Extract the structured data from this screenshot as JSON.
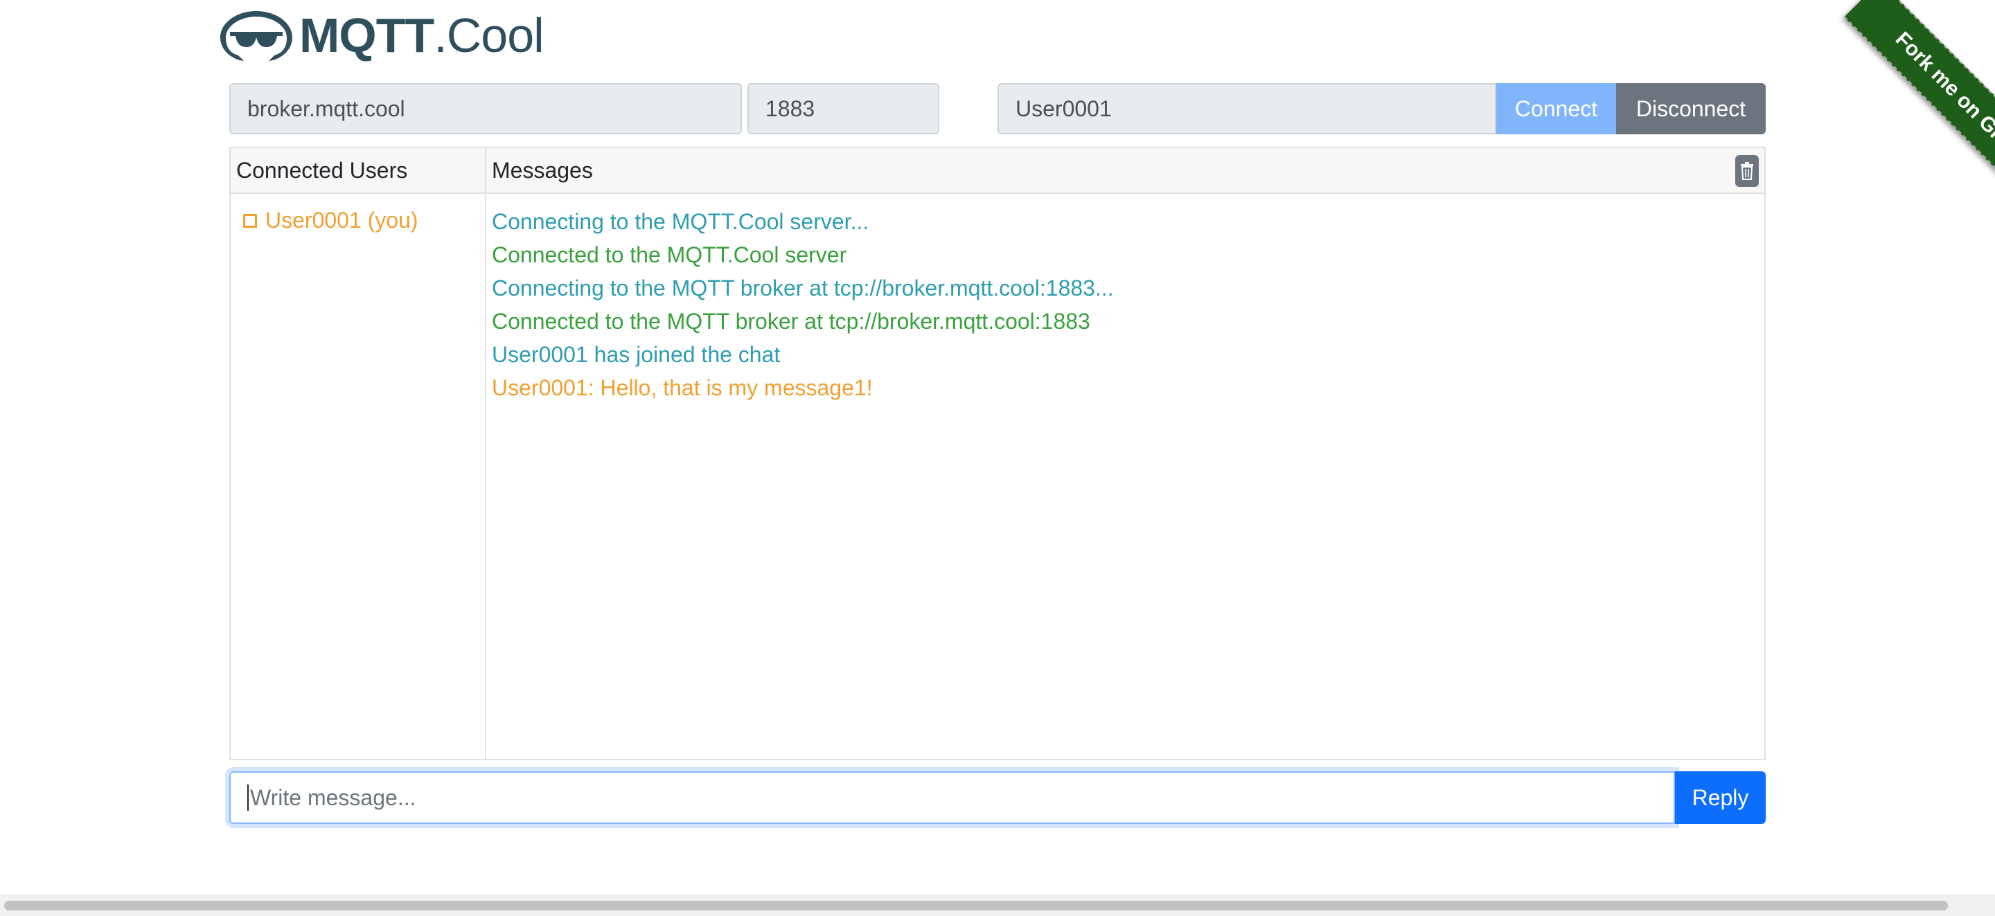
{
  "logo": {
    "bold": "MQTT",
    "light": ".Cool"
  },
  "connection": {
    "host_value": "broker.mqtt.cool",
    "port_value": "1883",
    "username_value": "User0001",
    "connect_label": "Connect",
    "disconnect_label": "Disconnect"
  },
  "users_panel": {
    "title": "Connected Users",
    "users": [
      "User0001 (you)"
    ]
  },
  "messages_panel": {
    "title": "Messages",
    "clear_icon": "trash-icon",
    "messages": [
      {
        "text": "Connecting to the MQTT.Cool server...",
        "color": "#2e9db0"
      },
      {
        "text": "Connected to the MQTT.Cool server",
        "color": "#3aa13f"
      },
      {
        "text": "Connecting to the MQTT broker at tcp://broker.mqtt.cool:1883...",
        "color": "#2e9db0"
      },
      {
        "text": "Connected to the MQTT broker at tcp://broker.mqtt.cool:1883",
        "color": "#3aa13f"
      },
      {
        "text": "User0001 has joined the chat",
        "color": "#2e9db0"
      },
      {
        "text": "User0001: Hello, that is my message1!",
        "color": "#f0a030"
      }
    ]
  },
  "composer": {
    "placeholder": "Write message...",
    "reply_label": "Reply"
  },
  "ribbon": {
    "label": "Fork me on GitHub"
  }
}
